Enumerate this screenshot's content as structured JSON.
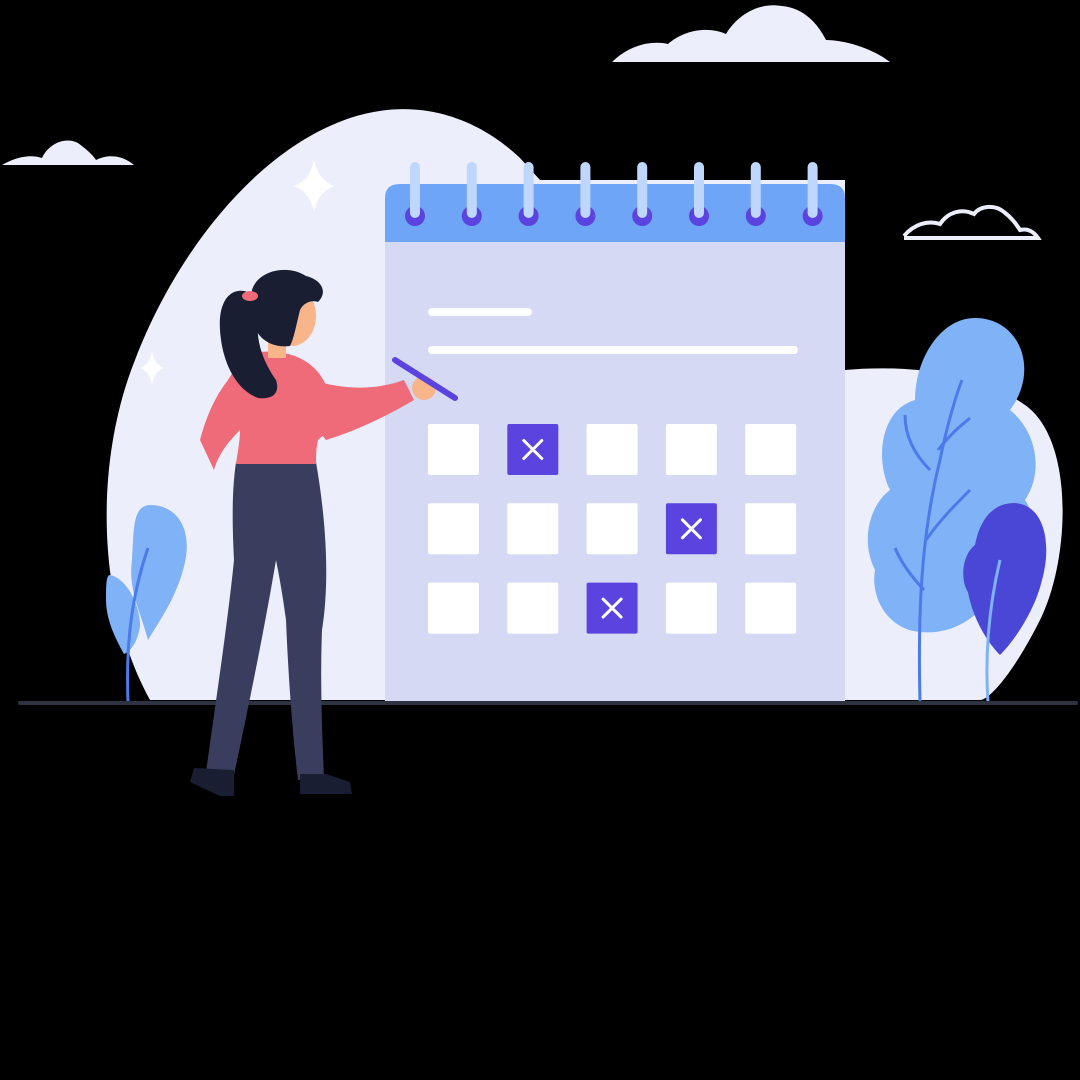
{
  "illustration": {
    "subject": "woman-marking-calendar",
    "calendar": {
      "rows": 3,
      "columns": 5,
      "ring_count": 8,
      "marked_cells": [
        {
          "row": 1,
          "col": 2
        },
        {
          "row": 2,
          "col": 4
        },
        {
          "row": 3,
          "col": 3
        }
      ],
      "mark_glyph": "x-icon"
    },
    "colors": {
      "background": "#000000",
      "blob": "#ECEEFB",
      "cloud": "#ECEEFB",
      "calendar_body": "#D5D9F3",
      "calendar_header": "#6FA5F7",
      "ring_hole": "#5B43E0",
      "ring": "#BFD7FD",
      "cell": "#FFFFFF",
      "cell_marked": "#5B43E0",
      "shirt": "#F06B7A",
      "pants": "#3A3E5E",
      "hair": "#1A1E33",
      "skin": "#F8B58A",
      "tree_light": "#7FB2F6",
      "tree_dark": "#4B47D6",
      "ground": "#2D3340"
    }
  }
}
